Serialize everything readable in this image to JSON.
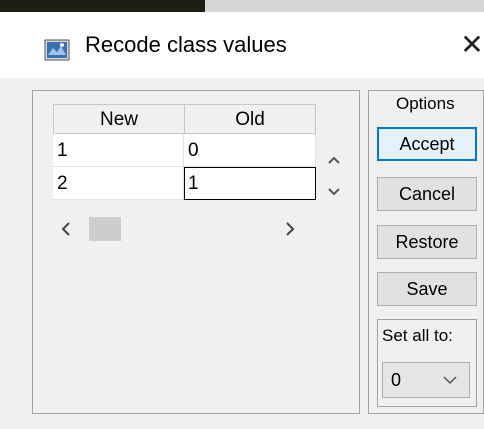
{
  "window": {
    "title": "Recode class values",
    "close_glyph": "✕"
  },
  "table": {
    "columns": [
      "New",
      "Old"
    ],
    "rows": [
      {
        "new": "1",
        "old": "0"
      },
      {
        "new": "2",
        "old": "1"
      }
    ],
    "scroll_up_glyph": "^",
    "scroll_down_glyph": "v",
    "scroll_left_glyph": "<",
    "scroll_right_glyph": ">"
  },
  "options": {
    "group_label": "Options",
    "accept_label": "Accept",
    "cancel_label": "Cancel",
    "restore_label": "Restore",
    "save_label": "Save",
    "set_all_label": "Set all to:",
    "set_all_value": "0"
  },
  "icons": {
    "app": "recode-app-icon",
    "close": "close-icon",
    "dropdown": "chevron-down-icon"
  },
  "colors": {
    "default_button_border": "#0078d7",
    "titlebar_bg": "#ffffff",
    "window_bg": "#f0f0f0"
  }
}
